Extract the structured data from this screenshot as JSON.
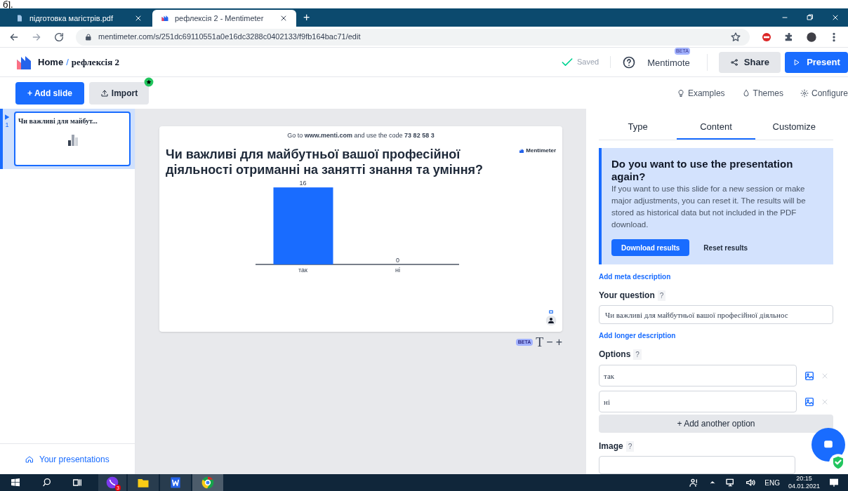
{
  "page_fragment": "б].",
  "browser": {
    "tabs": [
      {
        "title": "підготовка магістрів.pdf",
        "kind": "file",
        "selected": false
      },
      {
        "title": "рефлексія 2 - Mentimeter",
        "kind": "menti",
        "selected": true
      }
    ],
    "new_tab": "+",
    "url": "mentimeter.com/s/251dc69110551a0e16dc3288c0402133/f9fb164bac71/edit"
  },
  "header": {
    "home": "Home",
    "separator": "/",
    "title": "рефлексія 2",
    "saved": "Saved",
    "mentimote": "Mentimote",
    "beta": "BETA",
    "share": "Share",
    "present": "Present"
  },
  "toolbar": {
    "add_slide": "+ Add slide",
    "import": "Import",
    "links": [
      {
        "label": "Examples",
        "kind": "bulb"
      },
      {
        "label": "Themes",
        "kind": "drop"
      },
      {
        "label": "Configure",
        "kind": "gear"
      }
    ]
  },
  "slides": [
    {
      "number": "1",
      "title": "Чи важливі для майбут...",
      "selected": true
    }
  ],
  "your_presentations": "Your presentations",
  "slide": {
    "join": "Go to **www.menti.com** and use the code **73 82 58 3**",
    "logo": "Mentimeter",
    "question": "Чи важливі для майбутньої вашої професійної діяльності отриманні на занятті знання та уміння?",
    "chart_data": {
      "type": "bar",
      "categories": [
        "так",
        "ні"
      ],
      "values": [
        16,
        0
      ],
      "data_labels": true
    }
  },
  "text_controls": {
    "beta": "BETA",
    "font": "T",
    "minus": "−",
    "plus": "+"
  },
  "panel": {
    "tabs": [
      {
        "label": "Type",
        "selected": false
      },
      {
        "label": "Content",
        "selected": true
      },
      {
        "label": "Customize",
        "selected": false
      }
    ],
    "notice": {
      "title": "Do you want to use the presentation again?",
      "body": "If you want to use this slide for a new session or make major adjustments, you can reset it. The results will be stored as historical data but not included in the PDF download.",
      "download": "Download results",
      "reset": "Reset results"
    },
    "add_meta": "Add meta description",
    "question_label": "Your question",
    "help": "?",
    "question_value": "Чи важливі для майбутньої вашої професійної діяльнос",
    "add_longer": "Add longer description",
    "options_label": "Options",
    "options": [
      {
        "value": "так"
      },
      {
        "value": "ні"
      }
    ],
    "add_option": "+ Add another option",
    "image_label": "Image"
  },
  "taskbar": {
    "lang": "ENG",
    "time": "20:15",
    "date": "04.01.2021",
    "viber_badge": "3"
  }
}
